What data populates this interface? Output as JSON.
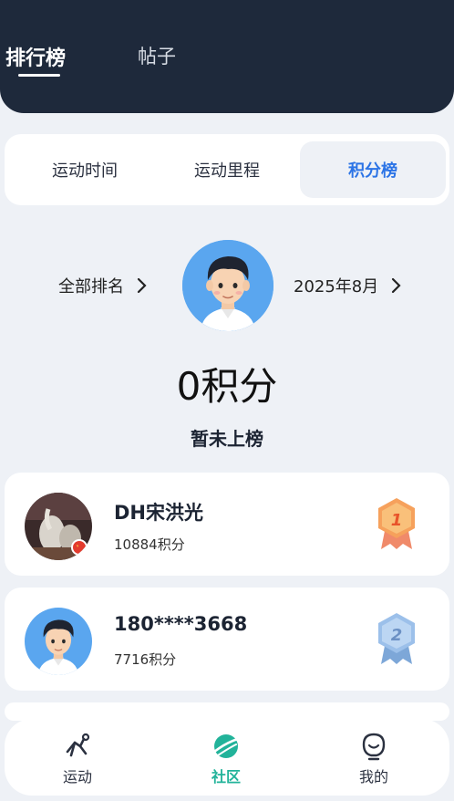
{
  "header": {
    "tabs": [
      {
        "label": "排行榜"
      },
      {
        "label": "帖子"
      }
    ]
  },
  "segments": {
    "items": [
      {
        "label": "运动时间"
      },
      {
        "label": "运动里程"
      },
      {
        "label": "积分榜"
      }
    ],
    "selected": "积分榜"
  },
  "me": {
    "scope_label": "全部排名",
    "period_label": "2025年8月",
    "score_text": "0积分",
    "rank_status": "暂未上榜"
  },
  "leaderboard": [
    {
      "name": "DH宋洪光",
      "points": "10884积分",
      "rank": "1",
      "badge_color": "#f4a261"
    },
    {
      "name": "180****3668",
      "points": "7716积分",
      "rank": "2",
      "badge_color": "#8fb8e8"
    }
  ],
  "bottom_nav": {
    "items": [
      {
        "label": "运动",
        "icon": "run-icon"
      },
      {
        "label": "社区",
        "icon": "planet-icon"
      },
      {
        "label": "我的",
        "icon": "face-icon"
      }
    ],
    "active": "社区",
    "active_color": "#22b39a"
  }
}
